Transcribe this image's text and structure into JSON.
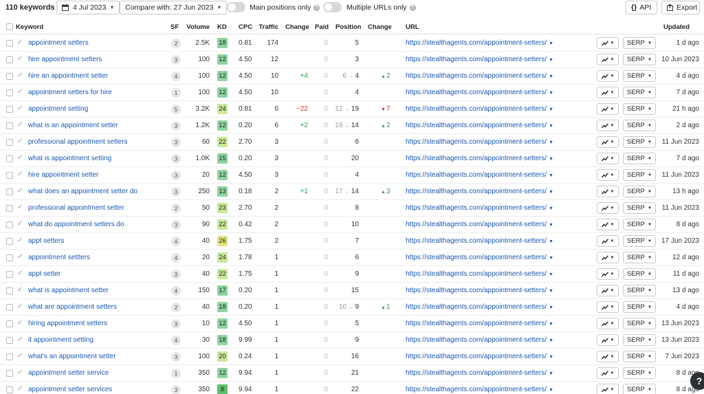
{
  "toolbar": {
    "keyword_count": "110 keywords",
    "date_label": "4 Jul 2023",
    "compare_label": "Compare with: 27 Jun 2023",
    "main_positions_label": "Main positions only",
    "multiple_urls_label": "Multiple URLs only",
    "api_label": "API",
    "export_label": "Export"
  },
  "icons": {
    "calendar": "calendar-icon",
    "chevron": "chevron-down-icon",
    "check": "check-icon",
    "help": "help-icon",
    "api": "braces-icon",
    "export": "export-icon",
    "chart": "line-chart-icon"
  },
  "colors": {
    "link": "#1a56b0",
    "positive": "#2f9d4a",
    "negative": "#d22d2d",
    "kd_green": "#8fd3a0",
    "kd_light_green": "#c9e89a",
    "kd_yellow": "#e2e37d"
  },
  "columns": {
    "keyword": "Keyword",
    "sf": "SF",
    "volume": "Volume",
    "kd": "KD",
    "cpc": "CPC",
    "traffic": "Traffic",
    "change": "Change",
    "paid": "Paid",
    "position": "Position",
    "pos_change": "Change",
    "url": "URL",
    "updated": "Updated"
  },
  "serp_label": "SERP",
  "help_bubble": "?",
  "rows": [
    {
      "keyword": "appointment setters",
      "sf": "2",
      "volume": "2.5K",
      "kd": "18",
      "kd_color": "#8fd3a0",
      "cpc": "0.81",
      "traffic": "174",
      "change": "",
      "change_dir": "",
      "paid": "0",
      "pos_prev": "",
      "position": "5",
      "pos_change": "",
      "pos_dir": "",
      "url": "https://stealthagents.com/appointment-setters/",
      "updated": "1 d ago"
    },
    {
      "keyword": "hire appointment setters",
      "sf": "3",
      "volume": "100",
      "kd": "12",
      "kd_color": "#8fd3a0",
      "cpc": "4.50",
      "traffic": "12",
      "change": "",
      "change_dir": "",
      "paid": "0",
      "pos_prev": "",
      "position": "3",
      "pos_change": "",
      "pos_dir": "",
      "url": "https://stealthagents.com/appointment-setters/",
      "updated": "10 Jun 2023"
    },
    {
      "keyword": "hire an appointment setter",
      "sf": "4",
      "volume": "100",
      "kd": "12",
      "kd_color": "#8fd3a0",
      "cpc": "4.50",
      "traffic": "10",
      "change": "+4",
      "change_dir": "up",
      "paid": "0",
      "pos_prev": "6",
      "position": "4",
      "pos_change": "2",
      "pos_dir": "up",
      "url": "https://stealthagents.com/appointment-setters/",
      "updated": "4 d ago"
    },
    {
      "keyword": "appointment setters for hire",
      "sf": "1",
      "volume": "100",
      "kd": "12",
      "kd_color": "#8fd3a0",
      "cpc": "4.50",
      "traffic": "10",
      "change": "",
      "change_dir": "",
      "paid": "0",
      "pos_prev": "",
      "position": "4",
      "pos_change": "",
      "pos_dir": "",
      "url": "https://stealthagents.com/appointment-setters/",
      "updated": "7 d ago"
    },
    {
      "keyword": "appointment setting",
      "sf": "5",
      "volume": "3.2K",
      "kd": "24",
      "kd_color": "#c9e89a",
      "cpc": "0.81",
      "traffic": "6",
      "change": "−22",
      "change_dir": "down",
      "paid": "0",
      "pos_prev": "12",
      "position": "19",
      "pos_change": "7",
      "pos_dir": "down",
      "url": "https://stealthagents.com/appointment-setters/",
      "updated": "21 h ago"
    },
    {
      "keyword": "what is an appointment setter",
      "sf": "3",
      "volume": "1.2K",
      "kd": "12",
      "kd_color": "#8fd3a0",
      "cpc": "0.20",
      "traffic": "6",
      "change": "+2",
      "change_dir": "up",
      "paid": "0",
      "pos_prev": "16",
      "position": "14",
      "pos_change": "2",
      "pos_dir": "up",
      "url": "https://stealthagents.com/appointment-setters/",
      "updated": "2 d ago"
    },
    {
      "keyword": "professional appointment setters",
      "sf": "3",
      "volume": "60",
      "kd": "22",
      "kd_color": "#c9e89a",
      "cpc": "2.70",
      "traffic": "3",
      "change": "",
      "change_dir": "",
      "paid": "0",
      "pos_prev": "",
      "position": "6",
      "pos_change": "",
      "pos_dir": "",
      "url": "https://stealthagents.com/appointment-setters/",
      "updated": "11 Jun 2023"
    },
    {
      "keyword": "what is appointment setting",
      "sf": "3",
      "volume": "1.0K",
      "kd": "15",
      "kd_color": "#8fd3a0",
      "cpc": "0.20",
      "traffic": "3",
      "change": "",
      "change_dir": "",
      "paid": "0",
      "pos_prev": "",
      "position": "20",
      "pos_change": "",
      "pos_dir": "",
      "url": "https://stealthagents.com/appointment-setters/",
      "updated": "7 d ago"
    },
    {
      "keyword": "hire appointment setter",
      "sf": "3",
      "volume": "20",
      "kd": "12",
      "kd_color": "#8fd3a0",
      "cpc": "4.50",
      "traffic": "3",
      "change": "",
      "change_dir": "",
      "paid": "0",
      "pos_prev": "",
      "position": "4",
      "pos_change": "",
      "pos_dir": "",
      "url": "https://stealthagents.com/appointment-setters/",
      "updated": "11 Jun 2023"
    },
    {
      "keyword": "what does an appointment setter do",
      "sf": "3",
      "volume": "250",
      "kd": "13",
      "kd_color": "#8fd3a0",
      "cpc": "0.18",
      "traffic": "2",
      "change": "+1",
      "change_dir": "up",
      "paid": "0",
      "pos_prev": "17",
      "position": "14",
      "pos_change": "3",
      "pos_dir": "up",
      "url": "https://stealthagents.com/appointment-setters/",
      "updated": "13 h ago"
    },
    {
      "keyword": "professional appointment setter",
      "sf": "2",
      "volume": "50",
      "kd": "23",
      "kd_color": "#c9e89a",
      "cpc": "2.70",
      "traffic": "2",
      "change": "",
      "change_dir": "",
      "paid": "0",
      "pos_prev": "",
      "position": "8",
      "pos_change": "",
      "pos_dir": "",
      "url": "https://stealthagents.com/appointment-setters/",
      "updated": "11 Jun 2023"
    },
    {
      "keyword": "what do appointment setters do",
      "sf": "3",
      "volume": "90",
      "kd": "22",
      "kd_color": "#c9e89a",
      "cpc": "0.42",
      "traffic": "2",
      "change": "",
      "change_dir": "",
      "paid": "0",
      "pos_prev": "",
      "position": "10",
      "pos_change": "",
      "pos_dir": "",
      "url": "https://stealthagents.com/appointment-setters/",
      "updated": "8 d ago"
    },
    {
      "keyword": "appt setters",
      "sf": "4",
      "volume": "40",
      "kd": "26",
      "kd_color": "#e2e37d",
      "cpc": "1.75",
      "traffic": "2",
      "change": "",
      "change_dir": "",
      "paid": "0",
      "pos_prev": "",
      "position": "7",
      "pos_change": "",
      "pos_dir": "",
      "url": "https://stealthagents.com/appointment-setters/",
      "updated": "17 Jun 2023"
    },
    {
      "keyword": "appointment settlers",
      "sf": "4",
      "volume": "20",
      "kd": "24",
      "kd_color": "#c9e89a",
      "cpc": "1.78",
      "traffic": "1",
      "change": "",
      "change_dir": "",
      "paid": "0",
      "pos_prev": "",
      "position": "6",
      "pos_change": "",
      "pos_dir": "",
      "url": "https://stealthagents.com/appointment-setters/",
      "updated": "12 d ago"
    },
    {
      "keyword": "appt setter",
      "sf": "3",
      "volume": "40",
      "kd": "22",
      "kd_color": "#c9e89a",
      "cpc": "1.75",
      "traffic": "1",
      "change": "",
      "change_dir": "",
      "paid": "0",
      "pos_prev": "",
      "position": "9",
      "pos_change": "",
      "pos_dir": "",
      "url": "https://stealthagents.com/appointment-setters/",
      "updated": "11 d ago"
    },
    {
      "keyword": "what is appointment setter",
      "sf": "4",
      "volume": "150",
      "kd": "17",
      "kd_color": "#8fd3a0",
      "cpc": "0.20",
      "traffic": "1",
      "change": "",
      "change_dir": "",
      "paid": "0",
      "pos_prev": "",
      "position": "15",
      "pos_change": "",
      "pos_dir": "",
      "url": "https://stealthagents.com/appointment-setters/",
      "updated": "13 d ago"
    },
    {
      "keyword": "what are appointment setters",
      "sf": "2",
      "volume": "40",
      "kd": "18",
      "kd_color": "#8fd3a0",
      "cpc": "0.20",
      "traffic": "1",
      "change": "",
      "change_dir": "",
      "paid": "0",
      "pos_prev": "10",
      "position": "9",
      "pos_change": "1",
      "pos_dir": "up",
      "url": "https://stealthagents.com/appointment-setters/",
      "updated": "4 d ago"
    },
    {
      "keyword": "hiring appointment setters",
      "sf": "3",
      "volume": "10",
      "kd": "12",
      "kd_color": "#8fd3a0",
      "cpc": "4.50",
      "traffic": "1",
      "change": "",
      "change_dir": "",
      "paid": "0",
      "pos_prev": "",
      "position": "5",
      "pos_change": "",
      "pos_dir": "",
      "url": "https://stealthagents.com/appointment-setters/",
      "updated": "13 Jun 2023"
    },
    {
      "keyword": "it appointment setting",
      "sf": "4",
      "volume": "30",
      "kd": "18",
      "kd_color": "#8fd3a0",
      "cpc": "9.99",
      "traffic": "1",
      "change": "",
      "change_dir": "",
      "paid": "0",
      "pos_prev": "",
      "position": "9",
      "pos_change": "",
      "pos_dir": "",
      "url": "https://stealthagents.com/appointment-setters/",
      "updated": "13 Jun 2023"
    },
    {
      "keyword": "what's an appointment setter",
      "sf": "3",
      "volume": "100",
      "kd": "20",
      "kd_color": "#c9e89a",
      "cpc": "0.24",
      "traffic": "1",
      "change": "",
      "change_dir": "",
      "paid": "0",
      "pos_prev": "",
      "position": "16",
      "pos_change": "",
      "pos_dir": "",
      "url": "https://stealthagents.com/appointment-setters/",
      "updated": "7 Jun 2023"
    },
    {
      "keyword": "appointment setter service",
      "sf": "1",
      "volume": "350",
      "kd": "12",
      "kd_color": "#8fd3a0",
      "cpc": "9.94",
      "traffic": "1",
      "change": "",
      "change_dir": "",
      "paid": "0",
      "pos_prev": "",
      "position": "21",
      "pos_change": "",
      "pos_dir": "",
      "url": "https://stealthagents.com/appointment-setters/",
      "updated": "8 d ago"
    },
    {
      "keyword": "appointment setter services",
      "sf": "3",
      "volume": "350",
      "kd": "8",
      "kd_color": "#5fbf6e",
      "cpc": "9.94",
      "traffic": "1",
      "change": "",
      "change_dir": "",
      "paid": "0",
      "pos_prev": "",
      "position": "22",
      "pos_change": "",
      "pos_dir": "",
      "url": "https://stealthagents.com/appointment-setters/",
      "updated": "8 d ago"
    }
  ]
}
